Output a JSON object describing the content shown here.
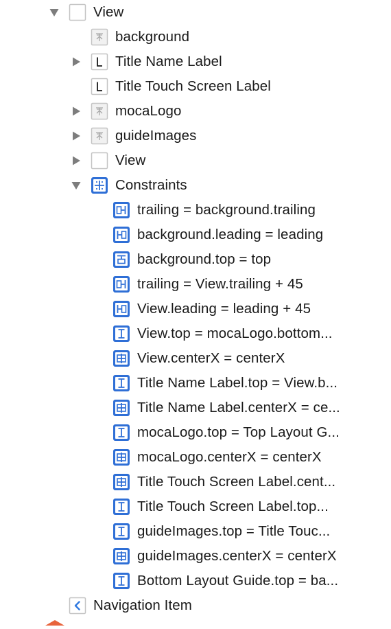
{
  "outline": {
    "rows": [
      {
        "label": "View",
        "icon": "view-icon",
        "disclosure": "expanded",
        "level": 0
      },
      {
        "label": "background",
        "icon": "image-view-icon",
        "disclosure": "none",
        "level": 1
      },
      {
        "label": "Title Name Label",
        "icon": "label-icon",
        "disclosure": "collapsed",
        "level": 1
      },
      {
        "label": "Title Touch Screen Label",
        "icon": "label-icon",
        "disclosure": "none",
        "level": 1
      },
      {
        "label": "mocaLogo",
        "icon": "image-view-icon",
        "disclosure": "collapsed",
        "level": 1
      },
      {
        "label": "guideImages",
        "icon": "image-view-icon",
        "disclosure": "collapsed",
        "level": 1
      },
      {
        "label": "View",
        "icon": "view-icon",
        "disclosure": "collapsed",
        "level": 1
      },
      {
        "label": "Constraints",
        "icon": "constraints-icon",
        "disclosure": "expanded",
        "level": 1
      },
      {
        "label": "trailing = background.trailing",
        "icon": "trailing-constraint-icon",
        "disclosure": "none",
        "level": 2
      },
      {
        "label": "background.leading = leading",
        "icon": "leading-constraint-icon",
        "disclosure": "none",
        "level": 2
      },
      {
        "label": "background.top = top",
        "icon": "top-constraint-icon",
        "disclosure": "none",
        "level": 2
      },
      {
        "label": "trailing = View.trailing + 45",
        "icon": "trailing-constraint-icon",
        "disclosure": "none",
        "level": 2
      },
      {
        "label": "View.leading = leading + 45",
        "icon": "leading-constraint-icon",
        "disclosure": "none",
        "level": 2
      },
      {
        "label": "View.top = mocaLogo.bottom...",
        "icon": "vertical-spacing-constraint-icon",
        "disclosure": "none",
        "level": 2
      },
      {
        "label": "View.centerX = centerX",
        "icon": "center-x-constraint-icon",
        "disclosure": "none",
        "level": 2
      },
      {
        "label": "Title Name Label.top = View.b...",
        "icon": "vertical-spacing-constraint-icon",
        "disclosure": "none",
        "level": 2
      },
      {
        "label": "Title Name Label.centerX = ce...",
        "icon": "center-x-constraint-icon",
        "disclosure": "none",
        "level": 2
      },
      {
        "label": "mocaLogo.top = Top Layout G...",
        "icon": "vertical-spacing-constraint-icon",
        "disclosure": "none",
        "level": 2
      },
      {
        "label": "mocaLogo.centerX = centerX",
        "icon": "center-x-constraint-icon",
        "disclosure": "none",
        "level": 2
      },
      {
        "label": "Title Touch Screen Label.cent...",
        "icon": "center-x-constraint-icon",
        "disclosure": "none",
        "level": 2
      },
      {
        "label": "Title Touch Screen Label.top...",
        "icon": "vertical-spacing-constraint-icon",
        "disclosure": "none",
        "level": 2
      },
      {
        "label": "guideImages.top = Title Touc...",
        "icon": "vertical-spacing-constraint-icon",
        "disclosure": "none",
        "level": 2
      },
      {
        "label": "guideImages.centerX = centerX",
        "icon": "center-x-constraint-icon",
        "disclosure": "none",
        "level": 2
      },
      {
        "label": "Bottom Layout Guide.top = ba...",
        "icon": "vertical-spacing-constraint-icon",
        "disclosure": "none",
        "level": 2
      },
      {
        "label": "Navigation Item",
        "icon": "navigation-item-icon",
        "disclosure": "none",
        "level": 0
      }
    ]
  },
  "colors": {
    "text": "#1a1a1a",
    "disclosure": "#7d7d7d",
    "constraint_blue": "#2f6fd6",
    "icon_border": "#c4c4c4",
    "nav_chevron": "#2f79e0",
    "accent_fragment": "#e8643c"
  }
}
